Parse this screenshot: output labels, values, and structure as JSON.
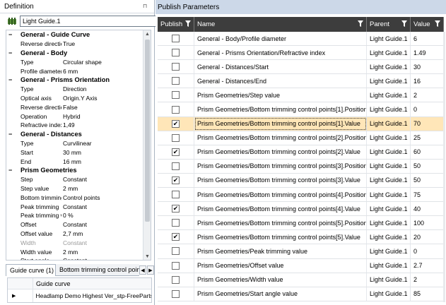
{
  "definition": {
    "title": "Definition",
    "pin_glyph": "⊓",
    "name_value": "Light Guide.1",
    "properties": [
      {
        "type": "category",
        "label": "General - Guide Curve"
      },
      {
        "type": "prop",
        "key": "Reverse direction",
        "value": "True"
      },
      {
        "type": "category",
        "label": "General - Body"
      },
      {
        "type": "prop",
        "key": "Type",
        "value": "Circular shape"
      },
      {
        "type": "prop",
        "key": "Profile diameter",
        "value": "6 mm"
      },
      {
        "type": "category",
        "label": "General - Prisms Orientation"
      },
      {
        "type": "prop",
        "key": "Type",
        "value": "Direction"
      },
      {
        "type": "prop",
        "key": "Optical axis",
        "value": "Origin.Y Axis"
      },
      {
        "type": "prop",
        "key": "Reverse direction",
        "value": "False"
      },
      {
        "type": "prop",
        "key": "Operation",
        "value": "Hybrid"
      },
      {
        "type": "prop",
        "key": "Refractive index",
        "value": "1,49"
      },
      {
        "type": "category",
        "label": "General - Distances"
      },
      {
        "type": "prop",
        "key": "Type",
        "value": "Curvilinear"
      },
      {
        "type": "prop",
        "key": "Start",
        "value": "30 mm"
      },
      {
        "type": "prop",
        "key": "End",
        "value": "16 mm"
      },
      {
        "type": "category",
        "label": "Prism Geometries"
      },
      {
        "type": "prop",
        "key": "Step",
        "value": "Constant"
      },
      {
        "type": "prop",
        "key": "Step value",
        "value": "2 mm"
      },
      {
        "type": "prop",
        "key": "Bottom trimming",
        "value": "Control points"
      },
      {
        "type": "prop",
        "key": "Peak trimming",
        "value": "Constant"
      },
      {
        "type": "prop",
        "key": "Peak trimming value",
        "value": "0 %"
      },
      {
        "type": "prop",
        "key": "Offset",
        "value": "Constant"
      },
      {
        "type": "prop",
        "key": "Offset value",
        "value": "2,7 mm"
      },
      {
        "type": "prop",
        "key": "Width",
        "value": "Constant",
        "disabled": true
      },
      {
        "type": "prop",
        "key": "Width value",
        "value": "2 mm"
      },
      {
        "type": "prop",
        "key": "Start angle",
        "value": "Constant"
      }
    ],
    "tabs": {
      "active": "Guide curve (1)",
      "inactive": "Bottom trimming control points"
    },
    "guide": {
      "header": "Guide curve",
      "row": "Headlamp Demo Highest Ver_stp-FreeParts"
    }
  },
  "publish": {
    "title": "Publish Parameters",
    "columns": {
      "publish": "Publish",
      "name": "Name",
      "parent": "Parent",
      "value": "Value"
    },
    "rows": [
      {
        "checked": false,
        "name": "General - Body/Profile diameter",
        "parent": "Light Guide.1",
        "value": "6"
      },
      {
        "checked": false,
        "name": "General - Prisms Orientation/Refractive index",
        "parent": "Light Guide.1",
        "value": "1.49"
      },
      {
        "checked": false,
        "name": "General - Distances/Start",
        "parent": "Light Guide.1",
        "value": "30"
      },
      {
        "checked": false,
        "name": "General - Distances/End",
        "parent": "Light Guide.1",
        "value": "16"
      },
      {
        "checked": false,
        "name": "Prism Geometries/Step value",
        "parent": "Light Guide.1",
        "value": "2"
      },
      {
        "checked": false,
        "name": "Prism Geometries/Bottom trimming control points[1].Position",
        "parent": "Light Guide.1",
        "value": "0"
      },
      {
        "checked": true,
        "name": "Prism Geometries/Bottom trimming control points[1].Value",
        "parent": "Light Guide.1",
        "value": "70",
        "selected": true
      },
      {
        "checked": false,
        "name": "Prism Geometries/Bottom trimming control points[2].Position",
        "parent": "Light Guide.1",
        "value": "25"
      },
      {
        "checked": true,
        "name": "Prism Geometries/Bottom trimming control points[2].Value",
        "parent": "Light Guide.1",
        "value": "60"
      },
      {
        "checked": false,
        "name": "Prism Geometries/Bottom trimming control points[3].Position",
        "parent": "Light Guide.1",
        "value": "50"
      },
      {
        "checked": true,
        "name": "Prism Geometries/Bottom trimming control points[3].Value",
        "parent": "Light Guide.1",
        "value": "50"
      },
      {
        "checked": false,
        "name": "Prism Geometries/Bottom trimming control points[4].Position",
        "parent": "Light Guide.1",
        "value": "75"
      },
      {
        "checked": true,
        "name": "Prism Geometries/Bottom trimming control points[4].Value",
        "parent": "Light Guide.1",
        "value": "40"
      },
      {
        "checked": false,
        "name": "Prism Geometries/Bottom trimming control points[5].Position",
        "parent": "Light Guide.1",
        "value": "100"
      },
      {
        "checked": true,
        "name": "Prism Geometries/Bottom trimming control points[5].Value",
        "parent": "Light Guide.1",
        "value": "20"
      },
      {
        "checked": false,
        "name": "Prism Geometries/Peak trimming value",
        "parent": "Light Guide.1",
        "value": "0"
      },
      {
        "checked": false,
        "name": "Prism Geometries/Offset value",
        "parent": "Light Guide.1",
        "value": "2.7"
      },
      {
        "checked": false,
        "name": "Prism Geometries/Width value",
        "parent": "Light Guide.1",
        "value": "2"
      },
      {
        "checked": false,
        "name": "Prism Geometries/Start angle value",
        "parent": "Light Guide.1",
        "value": "85"
      }
    ]
  },
  "colors": {
    "header_dark": "#3d3d3d",
    "title_blue": "#ccd8e8",
    "selected_row": "#ffe6b8"
  }
}
